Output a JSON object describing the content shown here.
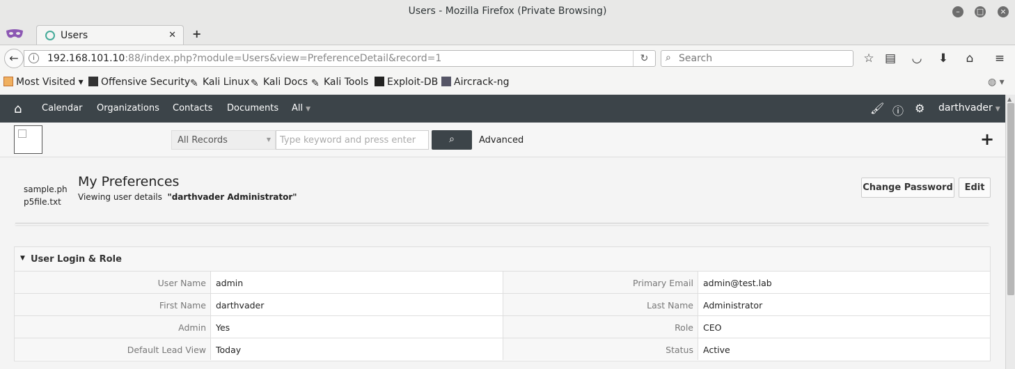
{
  "window": {
    "title": "Users - Mozilla Firefox (Private Browsing)"
  },
  "tab": {
    "label": "Users"
  },
  "nav": {
    "url_host": "192.168.101.10",
    "url_rest": ":88/index.php?module=Users&view=PreferenceDetail&record=1",
    "search_placeholder": "Search"
  },
  "bookmarks": [
    "Most Visited ▾",
    "Offensive Security",
    "Kali Linux",
    "Kali Docs",
    "Kali Tools",
    "Exploit-DB",
    "Aircrack-ng"
  ],
  "app": {
    "menu": [
      "Calendar",
      "Organizations",
      "Contacts",
      "Documents",
      "All"
    ],
    "user": "darthvader",
    "records_select": "All Records",
    "keyword_placeholder": "Type keyword and press enter",
    "advanced": "Advanced"
  },
  "page": {
    "attachment": "sample.php5file.txt",
    "title": "My Preferences",
    "subtitle_prefix": "Viewing user details",
    "subtitle_user": "\"darthvader Administrator\"",
    "change_password": "Change Password",
    "edit": "Edit"
  },
  "block": {
    "title": "User Login & Role",
    "rows": [
      {
        "l1": "User Name",
        "v1": "admin",
        "l2": "Primary Email",
        "v2": "admin@test.lab"
      },
      {
        "l1": "First Name",
        "v1": "darthvader",
        "l2": "Last Name",
        "v2": "Administrator"
      },
      {
        "l1": "Admin",
        "v1": "Yes",
        "l2": "Role",
        "v2": "CEO"
      },
      {
        "l1": "Default Lead View",
        "v1": "Today",
        "l2": "Status",
        "v2": "Active"
      }
    ]
  },
  "colors": {
    "appnav": "#3c4449",
    "background": "#f4f4f4"
  }
}
